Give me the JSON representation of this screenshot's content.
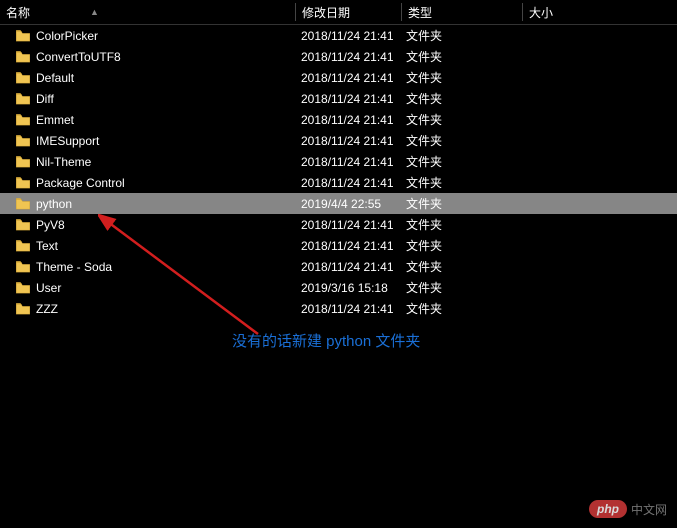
{
  "header": {
    "name": "名称",
    "date": "修改日期",
    "type": "类型",
    "size": "大小"
  },
  "rows": [
    {
      "name": "ColorPicker",
      "date": "2018/11/24 21:41",
      "type": "文件夹",
      "size": "",
      "selected": false
    },
    {
      "name": "ConvertToUTF8",
      "date": "2018/11/24 21:41",
      "type": "文件夹",
      "size": "",
      "selected": false
    },
    {
      "name": "Default",
      "date": "2018/11/24 21:41",
      "type": "文件夹",
      "size": "",
      "selected": false
    },
    {
      "name": "Diff",
      "date": "2018/11/24 21:41",
      "type": "文件夹",
      "size": "",
      "selected": false
    },
    {
      "name": "Emmet",
      "date": "2018/11/24 21:41",
      "type": "文件夹",
      "size": "",
      "selected": false
    },
    {
      "name": "IMESupport",
      "date": "2018/11/24 21:41",
      "type": "文件夹",
      "size": "",
      "selected": false
    },
    {
      "name": "Nil-Theme",
      "date": "2018/11/24 21:41",
      "type": "文件夹",
      "size": "",
      "selected": false
    },
    {
      "name": "Package Control",
      "date": "2018/11/24 21:41",
      "type": "文件夹",
      "size": "",
      "selected": false
    },
    {
      "name": "python",
      "date": "2019/4/4 22:55",
      "type": "文件夹",
      "size": "",
      "selected": true
    },
    {
      "name": "PyV8",
      "date": "2018/11/24 21:41",
      "type": "文件夹",
      "size": "",
      "selected": false
    },
    {
      "name": "Text",
      "date": "2018/11/24 21:41",
      "type": "文件夹",
      "size": "",
      "selected": false
    },
    {
      "name": "Theme - Soda",
      "date": "2018/11/24 21:41",
      "type": "文件夹",
      "size": "",
      "selected": false
    },
    {
      "name": "User",
      "date": "2019/3/16 15:18",
      "type": "文件夹",
      "size": "",
      "selected": false
    },
    {
      "name": "ZZZ",
      "date": "2018/11/24 21:41",
      "type": "文件夹",
      "size": "",
      "selected": false
    }
  ],
  "annotation": "没有的话新建 python 文件夹",
  "watermark": {
    "badge": "php",
    "text": "中文网"
  },
  "icon_colors": {
    "folder_fill": "#f0c552",
    "folder_stroke": "#c89a2e"
  }
}
